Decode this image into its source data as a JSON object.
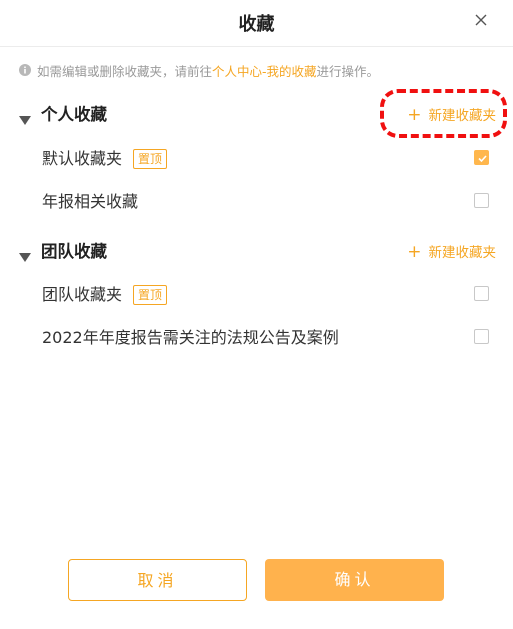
{
  "dialog": {
    "title": "收藏"
  },
  "notice": {
    "prefix": "如需编辑或删除收藏夹，请前往",
    "link": "个人中心-我的收藏",
    "suffix": "进行操作。"
  },
  "personal": {
    "title": "个人收藏",
    "new_folder": "新建收藏夹",
    "items": [
      {
        "label": "默认收藏夹",
        "badge": "置顶",
        "checked": true
      },
      {
        "label": "年报相关收藏",
        "badge": "",
        "checked": false
      }
    ]
  },
  "team": {
    "title": "团队收藏",
    "new_folder": "新建收藏夹",
    "items": [
      {
        "label": "团队收藏夹",
        "badge": "置顶",
        "checked": false
      },
      {
        "label": "2022年年度报告需关注的法规公告及案例",
        "badge": "",
        "checked": false
      }
    ]
  },
  "buttons": {
    "cancel": "取消",
    "confirm": "确认"
  },
  "colors": {
    "accent": "#f5a623",
    "confirm_bg": "#ffb24d",
    "highlight": "#f01010"
  }
}
